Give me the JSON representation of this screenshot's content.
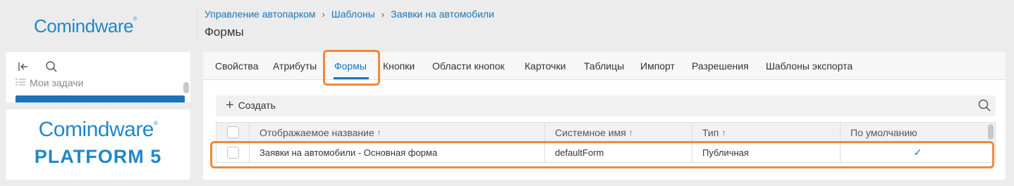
{
  "app": {
    "logo_text": "Comindware",
    "logo_reg": "®"
  },
  "header": {
    "breadcrumb": [
      "Управление автопарком",
      "Шаблоны",
      "Заявки на автомобили"
    ],
    "title": "Формы"
  },
  "nav": {
    "partial_item": "Мои задачи"
  },
  "platform_card": {
    "brand": "Comindware",
    "reg": "®",
    "product": "PLATFORM 5"
  },
  "tabs": [
    {
      "label": "Свойства",
      "active": false
    },
    {
      "label": "Атрибуты",
      "active": false
    },
    {
      "label": "Формы",
      "active": true
    },
    {
      "label": "Кнопки",
      "active": false
    },
    {
      "label": "Области кнопок",
      "active": false
    },
    {
      "label": "Карточки",
      "active": false
    },
    {
      "label": "Таблицы",
      "active": false
    },
    {
      "label": "Импорт",
      "active": false
    },
    {
      "label": "Разрешения",
      "active": false
    },
    {
      "label": "Шаблоны экспорта",
      "active": false
    }
  ],
  "toolbar": {
    "create_label": "Создать"
  },
  "table": {
    "columns": [
      {
        "label": "Отображаемое название",
        "sort": "↑"
      },
      {
        "label": "Системное имя",
        "sort": "↑"
      },
      {
        "label": "Тип",
        "sort": "↑"
      },
      {
        "label": "По умолчанию",
        "sort": ""
      }
    ],
    "rows": [
      {
        "display_name": "Заявки на автомобили - Основная форма",
        "system_name": "defaultForm",
        "type": "Публичная",
        "default_mark": "✓"
      }
    ]
  },
  "colors": {
    "accent": "#1d75b8",
    "logo": "#1e88c8",
    "highlight": "#f0893a"
  }
}
